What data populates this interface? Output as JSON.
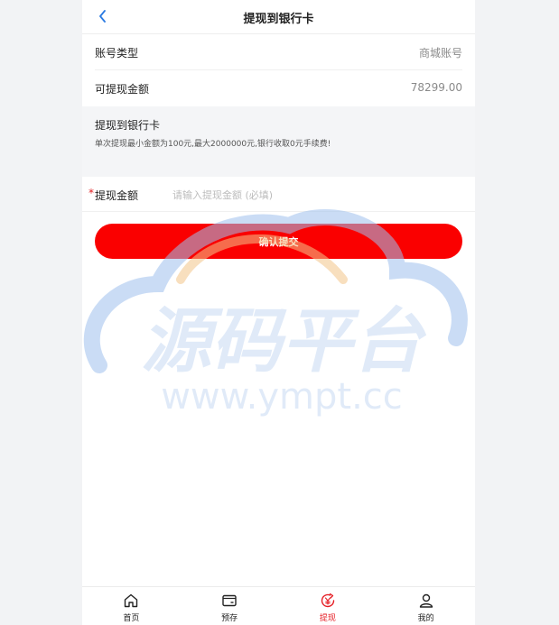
{
  "header": {
    "title": "提现到银行卡",
    "back_icon": "chevron-left-icon"
  },
  "account": {
    "label": "账号类型",
    "value": "商城账号"
  },
  "balance": {
    "label": "可提现金额",
    "value": "78299.00"
  },
  "info": {
    "title": "提现到银行卡",
    "description": "单次提现最小金额为100元,最大2000000元,银行收取0元手续费!"
  },
  "amount_field": {
    "required_mark": "*",
    "label": "提现金额",
    "placeholder": "请输入提现金额 (必填)",
    "value": ""
  },
  "submit": {
    "label": "确认提交"
  },
  "watermark": {
    "main": "源码平台",
    "url": "www.ympt.cc"
  },
  "tabs": [
    {
      "label": "首页",
      "icon": "home-icon"
    },
    {
      "label": "预存",
      "icon": "wallet-icon"
    },
    {
      "label": "提现",
      "icon": "withdraw-icon",
      "active": true
    },
    {
      "label": "我的",
      "icon": "user-icon"
    }
  ],
  "colors": {
    "accent": "#fa0000",
    "active_tab": "#e51c23",
    "back_icon": "#2a7ae2"
  }
}
